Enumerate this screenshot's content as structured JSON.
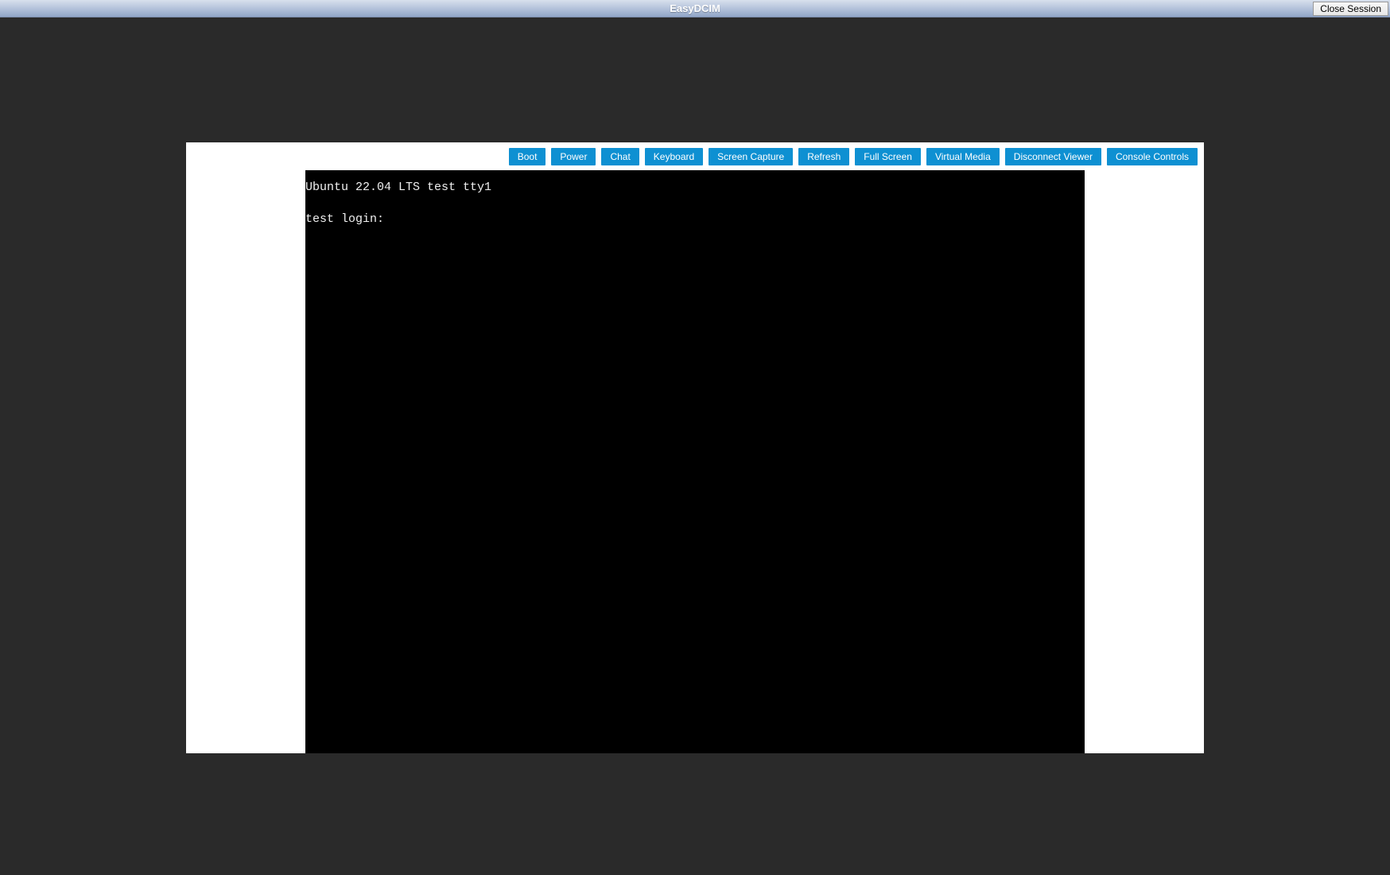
{
  "titlebar": {
    "title": "EasyDCIM",
    "close_button_label": "Close Session"
  },
  "toolbar": {
    "buttons": [
      "Boot",
      "Power",
      "Chat",
      "Keyboard",
      "Screen Capture",
      "Refresh",
      "Full Screen",
      "Virtual Media",
      "Disconnect Viewer",
      "Console Controls"
    ]
  },
  "terminal": {
    "line1": "Ubuntu 22.04 LTS test tty1",
    "line2": "test login:"
  }
}
